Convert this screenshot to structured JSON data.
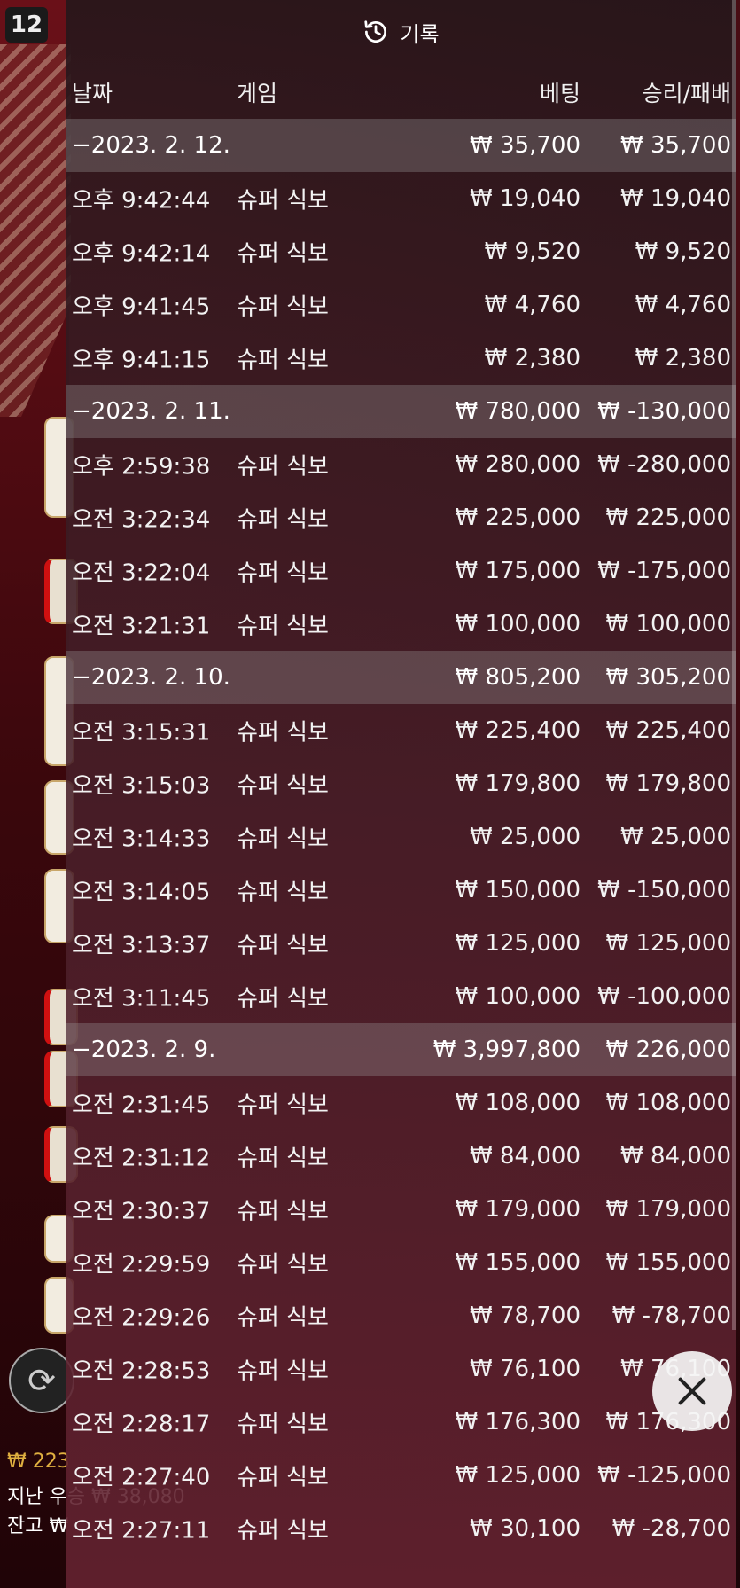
{
  "background": {
    "round_number": "12",
    "balance_prefix": "₩ 223",
    "last_win": "지난 우승 ₩ 38,080",
    "balance_label": "잔고 ₩"
  },
  "panel": {
    "title": "기록",
    "columns": {
      "date": "날짜",
      "game": "게임",
      "bet": "베팅",
      "win_loss": "승리/패배"
    },
    "sections": [
      {
        "date": "−2023. 2. 12.",
        "bet": "₩ 35,700",
        "win": "₩ 35,700",
        "rows": [
          {
            "time": "오후 9:42:44",
            "game": "슈퍼 식보",
            "bet": "₩ 19,040",
            "win": "₩ 19,040"
          },
          {
            "time": "오후 9:42:14",
            "game": "슈퍼 식보",
            "bet": "₩ 9,520",
            "win": "₩ 9,520"
          },
          {
            "time": "오후 9:41:45",
            "game": "슈퍼 식보",
            "bet": "₩ 4,760",
            "win": "₩ 4,760"
          },
          {
            "time": "오후 9:41:15",
            "game": "슈퍼 식보",
            "bet": "₩ 2,380",
            "win": "₩ 2,380"
          }
        ]
      },
      {
        "date": "−2023. 2. 11.",
        "bet": "₩ 780,000",
        "win": "₩ -130,000",
        "rows": [
          {
            "time": "오후 2:59:38",
            "game": "슈퍼 식보",
            "bet": "₩ 280,000",
            "win": "₩ -280,000"
          },
          {
            "time": "오전 3:22:34",
            "game": "슈퍼 식보",
            "bet": "₩ 225,000",
            "win": "₩ 225,000"
          },
          {
            "time": "오전 3:22:04",
            "game": "슈퍼 식보",
            "bet": "₩ 175,000",
            "win": "₩ -175,000"
          },
          {
            "time": "오전 3:21:31",
            "game": "슈퍼 식보",
            "bet": "₩ 100,000",
            "win": "₩ 100,000"
          }
        ]
      },
      {
        "date": "−2023. 2. 10.",
        "bet": "₩ 805,200",
        "win": "₩ 305,200",
        "rows": [
          {
            "time": "오전 3:15:31",
            "game": "슈퍼 식보",
            "bet": "₩ 225,400",
            "win": "₩ 225,400"
          },
          {
            "time": "오전 3:15:03",
            "game": "슈퍼 식보",
            "bet": "₩ 179,800",
            "win": "₩ 179,800"
          },
          {
            "time": "오전 3:14:33",
            "game": "슈퍼 식보",
            "bet": "₩ 25,000",
            "win": "₩ 25,000"
          },
          {
            "time": "오전 3:14:05",
            "game": "슈퍼 식보",
            "bet": "₩ 150,000",
            "win": "₩ -150,000"
          },
          {
            "time": "오전 3:13:37",
            "game": "슈퍼 식보",
            "bet": "₩ 125,000",
            "win": "₩ 125,000"
          },
          {
            "time": "오전 3:11:45",
            "game": "슈퍼 식보",
            "bet": "₩ 100,000",
            "win": "₩ -100,000"
          }
        ]
      },
      {
        "date": "−2023. 2. 9.",
        "bet": "₩ 3,997,800",
        "win": "₩ 226,000",
        "rows": [
          {
            "time": "오전 2:31:45",
            "game": "슈퍼 식보",
            "bet": "₩ 108,000",
            "win": "₩ 108,000"
          },
          {
            "time": "오전 2:31:12",
            "game": "슈퍼 식보",
            "bet": "₩ 84,000",
            "win": "₩ 84,000"
          },
          {
            "time": "오전 2:30:37",
            "game": "슈퍼 식보",
            "bet": "₩ 179,000",
            "win": "₩ 179,000"
          },
          {
            "time": "오전 2:29:59",
            "game": "슈퍼 식보",
            "bet": "₩ 155,000",
            "win": "₩ 155,000"
          },
          {
            "time": "오전 2:29:26",
            "game": "슈퍼 식보",
            "bet": "₩ 78,700",
            "win": "₩ -78,700"
          },
          {
            "time": "오전 2:28:53",
            "game": "슈퍼 식보",
            "bet": "₩ 76,100",
            "win": "₩ 76,100"
          },
          {
            "time": "오전 2:28:17",
            "game": "슈퍼 식보",
            "bet": "₩ 176,300",
            "win": "₩ 176,300"
          },
          {
            "time": "오전 2:27:40",
            "game": "슈퍼 식보",
            "bet": "₩ 125,000",
            "win": "₩ -125,000"
          },
          {
            "time": "오전 2:27:11",
            "game": "슈퍼 식보",
            "bet": "₩ 30,100",
            "win": "₩ -28,700"
          }
        ]
      }
    ]
  },
  "icons": {
    "history": "history-icon",
    "close": "close-icon",
    "repeat": "repeat-icon"
  }
}
